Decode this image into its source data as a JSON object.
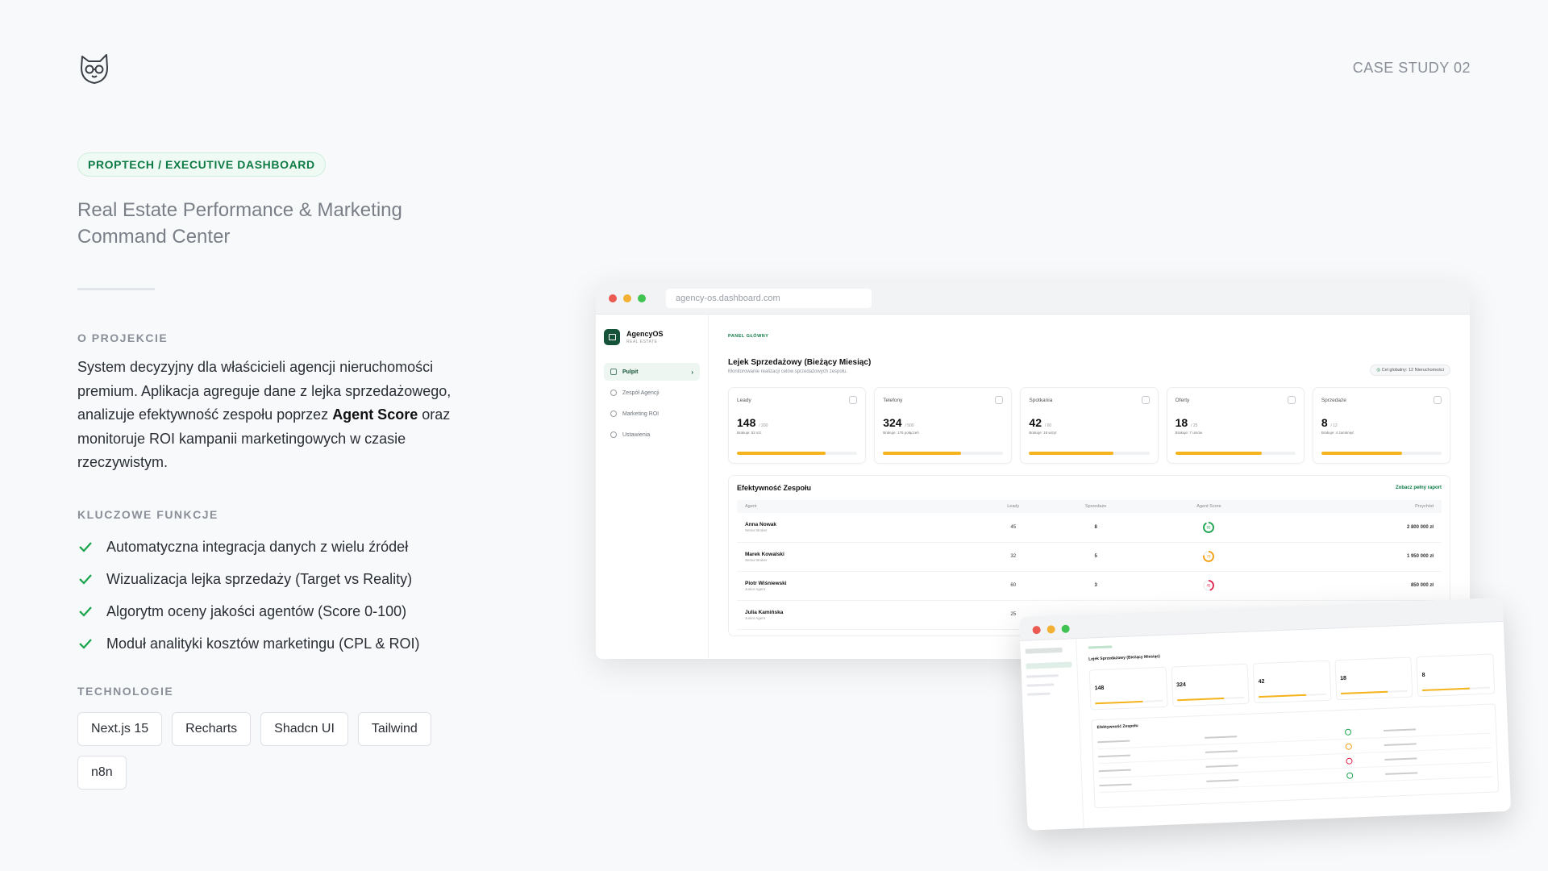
{
  "header": {
    "case_study": "CASE STUDY 02"
  },
  "hero": {
    "pill": "PROPTECH / EXECUTIVE DASHBOARD",
    "title": "Real Estate Performance & Marketing Command Center"
  },
  "about": {
    "label": "O PROJEKCIE",
    "text_before": "System decyzyjny dla właścicieli agencji nieruchomości premium. Aplikacja agreguje dane z lejka sprzedażowego, analizuje efektywność zespołu poprzez ",
    "text_bold": "Agent Score",
    "text_after": " oraz monitoruje ROI kampanii marketingowych w czasie rzeczywistym."
  },
  "features": {
    "label": "KLUCZOWE FUNKCJE",
    "items": [
      "Automatyczna integracja danych z wielu źródeł",
      "Wizualizacja lejka sprzedaży (Target vs Reality)",
      "Algorytm oceny jakości agentów (Score 0-100)",
      "Moduł analityki kosztów marketingu (CPL & ROI)"
    ]
  },
  "tech": {
    "label": "TECHNOLOGIE",
    "items": [
      "Next.js 15",
      "Recharts",
      "Shadcn UI",
      "Tailwind",
      "n8n"
    ]
  },
  "dashboard": {
    "url": "agency-os.dashboard.com",
    "brand": "AgencyOS",
    "brand_sub": "REAL ESTATE",
    "nav": [
      "Pulpit",
      "Zespół Agencji",
      "Marketing ROI",
      "Ustawienia"
    ],
    "crumb": "PANEL GŁÓWNY",
    "title": "Lejek Sprzedażowy (Bieżący Miesiąc)",
    "subtitle": "Monitorowanie realizacji celów sprzedażowych zespołu.",
    "goal": "Cel globalny: 12 Nieruchomości",
    "cards": [
      {
        "label": "Leady",
        "value": "148",
        "target": "/ 200",
        "note": "Brakuje: 52 szt.",
        "progress": 0.74
      },
      {
        "label": "Telefony",
        "value": "324",
        "target": "/ 500",
        "note": "Brakuje: 176 połączeń",
        "progress": 0.65
      },
      {
        "label": "Spotkania",
        "value": "42",
        "target": "/ 60",
        "note": "Brakuje: 18 wizyt",
        "progress": 0.7
      },
      {
        "label": "Oferty",
        "value": "18",
        "target": "/ 25",
        "note": "Brakuje: 7 umów",
        "progress": 0.72
      },
      {
        "label": "Sprzedaże",
        "value": "8",
        "target": "/ 12",
        "note": "Brakuje: 4 zamknięć",
        "progress": 0.67
      }
    ],
    "team": {
      "title": "Efektywność Zespołu",
      "link": "Zobacz pełny raport",
      "columns": [
        "Agent",
        "Leady",
        "Sprzedaże",
        "Agent Score",
        "Przychód"
      ],
      "rows": [
        {
          "name": "Anna Nowak",
          "role": "Senior Broker",
          "leads": "45",
          "sales": "8",
          "score": 92,
          "color": "#16a34a",
          "revenue": "2 800 000 zł"
        },
        {
          "name": "Marek Kowalski",
          "role": "Senior Broker",
          "leads": "32",
          "sales": "5",
          "score": 78,
          "color": "#f59e0b",
          "revenue": "1 950 000 zł"
        },
        {
          "name": "Piotr Wiśniewski",
          "role": "Junior Agent",
          "leads": "60",
          "sales": "3",
          "score": 45,
          "color": "#e11d48",
          "revenue": "850 000 zł"
        },
        {
          "name": "Julia Kamińska",
          "role": "Junior Agent",
          "leads": "25",
          "sales": "",
          "score": null,
          "color": "#16a34a",
          "revenue": ""
        }
      ]
    }
  }
}
